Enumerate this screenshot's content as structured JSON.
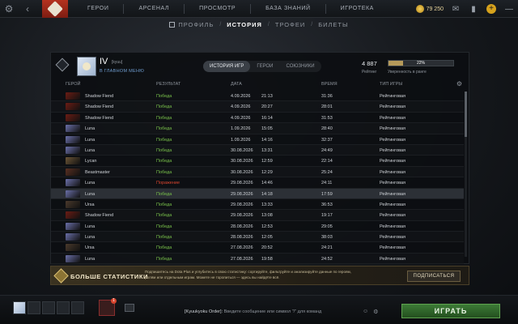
{
  "topbar": {
    "nav": [
      "ГЕРОИ",
      "АРСЕНАЛ",
      "ПРОСМОТР",
      "БАЗА ЗНАНИЙ",
      "ИГРОТЕКА"
    ],
    "currency": "79 250"
  },
  "subnav": {
    "tabs": [
      {
        "label": "ПРОФИЛЬ",
        "active": false
      },
      {
        "label": "ИСТОРИЯ",
        "active": true
      },
      {
        "label": "ТРОФЕИ",
        "active": false
      },
      {
        "label": "БИЛЕТЫ",
        "active": false
      }
    ]
  },
  "profile": {
    "name": "IV",
    "tag": "[kyuu]",
    "status": "В ГЛАВНОМ МЕНЮ",
    "rating": "4 887",
    "rating_label": "Рейтинг",
    "confidence": "22%",
    "confidence_value": 0.22,
    "confidence_label": "Уверенность в ранге"
  },
  "history_tabs": [
    "ИСТОРИЯ ИГР",
    "ГЕРОИ",
    "СОЮЗНИКИ"
  ],
  "columns": {
    "hero": "ГЕРОЙ",
    "result": "РЕЗУЛЬТАТ",
    "date": "ДАТА",
    "duration": "ВРЕМЯ",
    "type": "ТИП ИГРЫ"
  },
  "matches": [
    {
      "hero": "Shadow Fiend",
      "result": "Победа",
      "date": "4.09.2026",
      "time": "21:13",
      "duration": "31:36",
      "type": "Рейтинговая",
      "win": true,
      "color": "#6b1c14"
    },
    {
      "hero": "Shadow Fiend",
      "result": "Победа",
      "date": "4.09.2026",
      "time": "20:27",
      "duration": "28:01",
      "type": "Рейтинговая",
      "win": true,
      "color": "#6b1c14"
    },
    {
      "hero": "Shadow Fiend",
      "result": "Победа",
      "date": "4.09.2026",
      "time": "16:14",
      "duration": "31:53",
      "type": "Рейтинговая",
      "win": true,
      "color": "#6b1c14"
    },
    {
      "hero": "Luna",
      "result": "Победа",
      "date": "1.09.2026",
      "time": "15:05",
      "duration": "28:40",
      "type": "Рейтинговая",
      "win": true,
      "color": "#6a6fa8"
    },
    {
      "hero": "Luna",
      "result": "Победа",
      "date": "1.09.2026",
      "time": "14:16",
      "duration": "32:37",
      "type": "Рейтинговая",
      "win": true,
      "color": "#6a6fa8"
    },
    {
      "hero": "Luna",
      "result": "Победа",
      "date": "30.08.2026",
      "time": "13:31",
      "duration": "24:49",
      "type": "Рейтинговая",
      "win": true,
      "color": "#6a6fa8"
    },
    {
      "hero": "Lycan",
      "result": "Победа",
      "date": "30.08.2026",
      "time": "12:59",
      "duration": "22:14",
      "type": "Рейтинговая",
      "win": true,
      "color": "#6b5536"
    },
    {
      "hero": "Beastmaster",
      "result": "Победа",
      "date": "30.08.2026",
      "time": "12:29",
      "duration": "25:24",
      "type": "Рейтинговая",
      "win": true,
      "color": "#5a3022"
    },
    {
      "hero": "Luna",
      "result": "Поражение",
      "date": "29.08.2026",
      "time": "14:46",
      "duration": "24:11",
      "type": "Рейтинговая",
      "win": false,
      "color": "#6a6fa8"
    },
    {
      "hero": "Luna",
      "result": "Победа",
      "date": "29.08.2026",
      "time": "14:18",
      "duration": "17:59",
      "type": "Рейтинговая",
      "win": true,
      "color": "#6a6fa8",
      "highlight": true
    },
    {
      "hero": "Ursa",
      "result": "Победа",
      "date": "29.08.2026",
      "time": "13:33",
      "duration": "36:53",
      "type": "Рейтинговая",
      "win": true,
      "color": "#4a3a2c"
    },
    {
      "hero": "Shadow Fiend",
      "result": "Победа",
      "date": "29.08.2026",
      "time": "13:08",
      "duration": "19:17",
      "type": "Рейтинговая",
      "win": true,
      "color": "#6b1c14"
    },
    {
      "hero": "Luna",
      "result": "Победа",
      "date": "28.08.2026",
      "time": "12:53",
      "duration": "29:05",
      "type": "Рейтинговая",
      "win": true,
      "color": "#6a6fa8"
    },
    {
      "hero": "Luna",
      "result": "Победа",
      "date": "28.08.2026",
      "time": "12:05",
      "duration": "38:03",
      "type": "Рейтинговая",
      "win": true,
      "color": "#6a6fa8"
    },
    {
      "hero": "Ursa",
      "result": "Победа",
      "date": "27.08.2026",
      "time": "20:52",
      "duration": "24:21",
      "type": "Рейтинговая",
      "win": true,
      "color": "#4a3a2c"
    },
    {
      "hero": "Luna",
      "result": "Победа",
      "date": "27.08.2026",
      "time": "19:58",
      "duration": "24:52",
      "type": "Рейтинговая",
      "win": true,
      "color": "#6a6fa8"
    }
  ],
  "banner": {
    "title": "БОЛЬШЕ СТАТИСТИКИ",
    "text": "Подпишитесь на Dota Plus и углубитесь в свою статистику: сортируйте, фильтруйте и анализируйте данные по героям, ролям или отдельным играм. Можете не торопиться — здесь вы найдёте всё.",
    "button": "ПОДПИСАТЬСЯ"
  },
  "bottombar": {
    "chat_user": "[Kyuukyoku Order]:",
    "chat_placeholder": "Введите сообщение или символ \"/\" для команд",
    "play": "ИГРАТЬ",
    "badge": "1"
  }
}
